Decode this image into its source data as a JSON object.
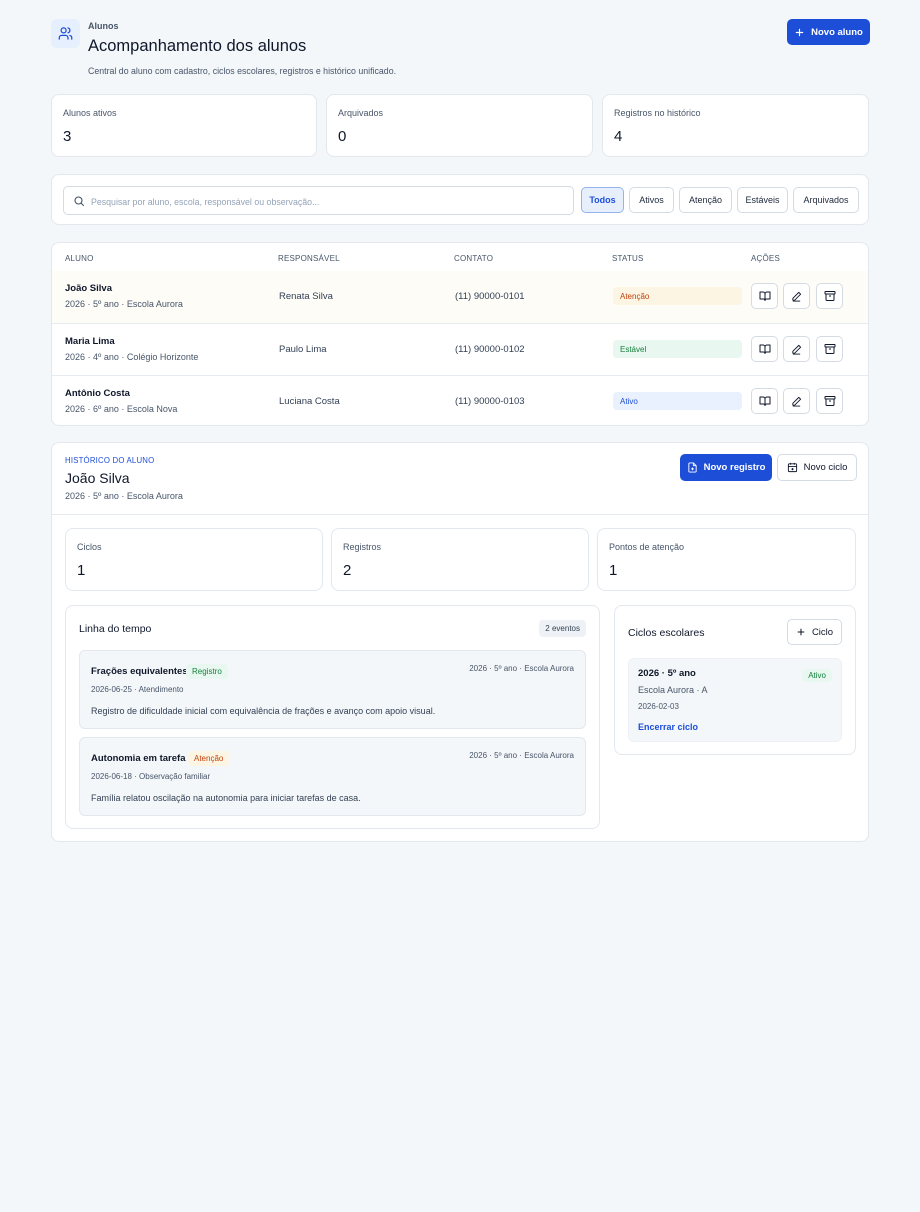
{
  "header": {
    "eyebrow": "Alunos",
    "title": "Acompanhamento dos alunos",
    "subtitle": "Central do aluno com cadastro, ciclos escolares, registros e histórico unificado.",
    "new_student": "Novo aluno",
    "icon": "users-icon"
  },
  "stats": [
    {
      "label": "Alunos ativos",
      "value": "3"
    },
    {
      "label": "Arquivados",
      "value": "0"
    },
    {
      "label": "Registros no histórico",
      "value": "4"
    }
  ],
  "search": {
    "placeholder": "Pesquisar por aluno, escola, responsável ou observação..."
  },
  "filters": [
    "Todos",
    "Ativos",
    "Atenção",
    "Estáveis",
    "Arquivados"
  ],
  "table": {
    "headers": [
      "ALUNO",
      "RESPONSÁVEL",
      "CONTATO",
      "STATUS",
      "AÇÕES"
    ],
    "rows": [
      {
        "name": "João Silva",
        "sub": "2026 · 5º ano · Escola Aurora",
        "guardian": "Renata Silva",
        "contact": "(11) 90000-0101",
        "status": "Atenção"
      },
      {
        "name": "Maria Lima",
        "sub": "2026 · 4º ano · Colégio Horizonte",
        "guardian": "Paulo Lima",
        "contact": "(11) 90000-0102",
        "status": "Estável"
      },
      {
        "name": "Antônio Costa",
        "sub": "2026 · 6º ano · Escola Nova",
        "guardian": "Luciana Costa",
        "contact": "(11) 90000-0103",
        "status": "Ativo"
      }
    ]
  },
  "history": {
    "eyebrow": "HISTÓRICO DO ALUNO",
    "name": "João Silva",
    "sub": "2026 · 5º ano · Escola Aurora",
    "new_record": "Novo registro",
    "new_cycle": "Novo ciclo",
    "stats": [
      {
        "label": "Ciclos",
        "value": "1"
      },
      {
        "label": "Registros",
        "value": "2"
      },
      {
        "label": "Pontos de atenção",
        "value": "1"
      }
    ],
    "timeline": {
      "title": "Linha do tempo",
      "count": "2 eventos",
      "events": [
        {
          "title": "Frações equivalentes",
          "tag": "Registro",
          "right": "2026 · 5º ano · Escola Aurora",
          "meta": "2026-06-25 · Atendimento",
          "desc": "Registro de dificuldade inicial com equivalência de frações e avanço com apoio visual."
        },
        {
          "title": "Autonomia em tarefa",
          "tag": "Atenção",
          "right": "2026 · 5º ano · Escola Aurora",
          "meta": "2026-06-18 · Observação familiar",
          "desc": "Família relatou oscilação na autonomia para iniciar tarefas de casa."
        }
      ]
    },
    "cycles": {
      "title": "Ciclos escolares",
      "add": "Ciclo",
      "items": [
        {
          "name": "2026 · 5º ano",
          "school": "Escola Aurora · A",
          "date": "2026-02-03",
          "status": "Ativo",
          "action": "Encerrar ciclo"
        }
      ]
    }
  },
  "colors": {
    "primary": "#1d4ed8",
    "warn": "#c2410c",
    "ok": "#15803d",
    "background": "#f4f7f9"
  }
}
